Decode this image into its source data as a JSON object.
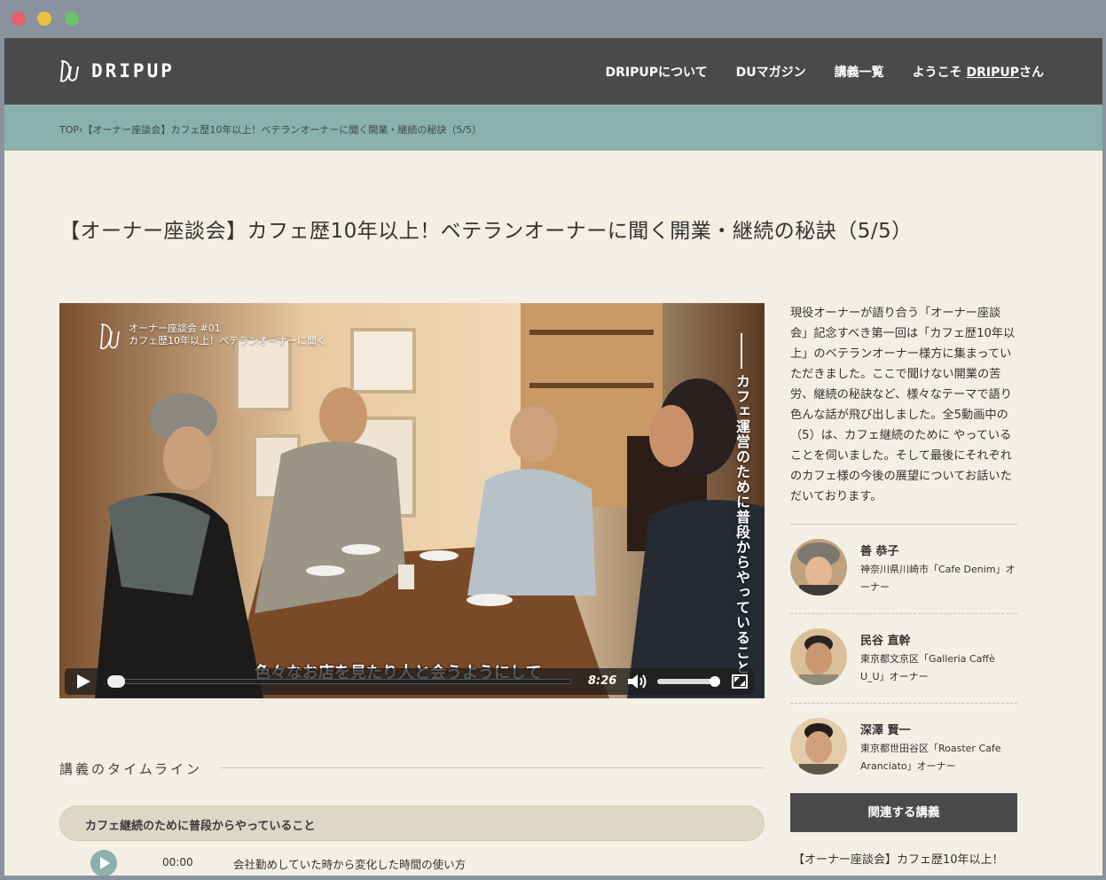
{
  "header": {
    "logo_text": "DRIPUP",
    "nav": [
      {
        "label": "DRIPUPについて"
      },
      {
        "label": "DUマガジン"
      },
      {
        "label": "講義一覧"
      }
    ],
    "welcome_prefix": "ようこそ ",
    "welcome_user": "DRIPUP",
    "welcome_suffix": "さん"
  },
  "breadcrumb": {
    "top": "TOP",
    "separator": "›",
    "current": "【オーナー座談会】カフェ歴10年以上！ベテランオーナーに聞く開業・継続の秘訣（5/5）"
  },
  "page_title": "【オーナー座談会】カフェ歴10年以上！ベテランオーナーに聞く開業・継続の秘訣（5/5）",
  "video": {
    "overlay_line1": "オーナー座談会 #01",
    "overlay_line2": "カフェ歴10年以上！ベテランオーナーに聞く",
    "vertical_caption": "カフェ運営のために普段からやっていること",
    "subtitle": "色々なお店を見たり人と会うようにして",
    "duration": "8:26"
  },
  "description": "現役オーナーが語り合う「オーナー座談会」記念すべき第一回は「カフェ歴10年以上」のベテランオーナー様方に集まっていただきました。ここで聞けない開業の苦労、継続の秘訣など、様々なテーマで語り色んな話が飛び出しました。全5動画中の（5）は、カフェ継続のために やっていることを伺いました。そして最後にそれぞれのカフェ様の今後の展望についてお話いただいております。",
  "people": [
    {
      "name": "善 恭子",
      "info": "神奈川県川崎市「Cafe Denim」オーナー"
    },
    {
      "name": "民谷 直幹",
      "info": "東京都文京区「Galleria Caffè U_U」オーナー"
    },
    {
      "name": "深澤 賢一",
      "info": "東京都世田谷区「Roaster Cafe Aranciato」オーナー"
    }
  ],
  "related": {
    "heading": "関連する講義",
    "first_item": "【オーナー座談会】カフェ歴10年以上！"
  },
  "timeline": {
    "heading": "講義のタイムライン",
    "chapter": "カフェ継続のために普段からやっていること",
    "entries": [
      {
        "time": "00:00",
        "text": "会社勤めしていた時から変化した時間の使い方"
      }
    ]
  },
  "colors": {
    "header_bg": "#4a4a4a",
    "breadcrumb_bg": "#8bb1ad",
    "page_bg": "#f3efe5",
    "chapter_bg": "#ddd7c5"
  }
}
